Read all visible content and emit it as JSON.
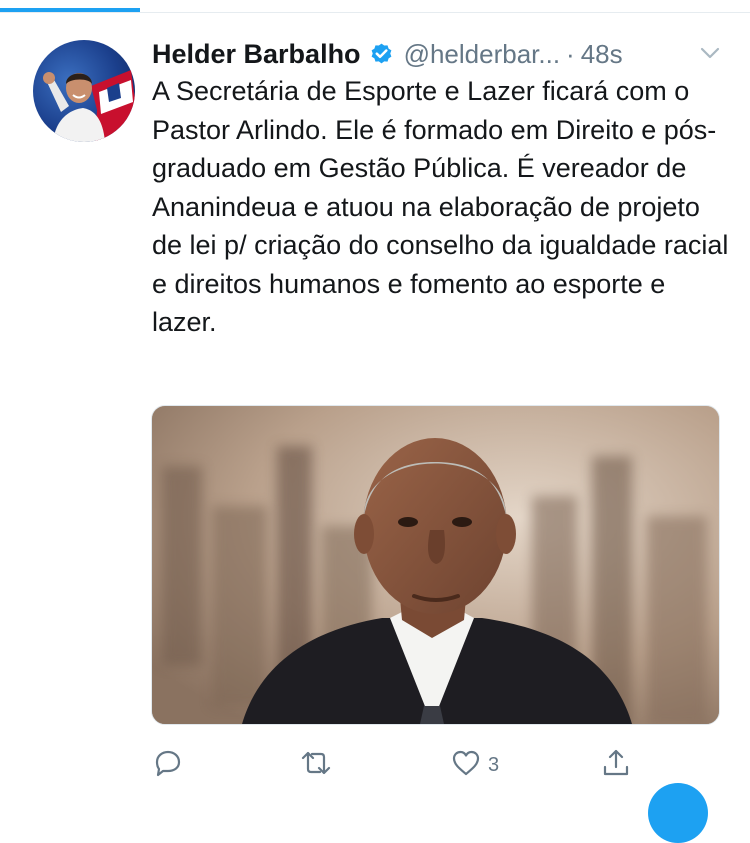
{
  "tweet": {
    "display_name": "Helder Barbalho",
    "handle": "@helderbar...",
    "separator": "·",
    "time": "48s",
    "text": "A Secretária de Esporte e Lazer ficará com o Pastor Arlindo. Ele é formado em Direito e pós-graduado em Gestão Pública. É vereador de Ananindeua e atuou na elaboração de projeto de lei p/ criação do conselho da igualdade racial e direitos humanos e fomento ao esporte e lazer."
  },
  "actions": {
    "like_count": "3"
  },
  "icons": {
    "verified": "verified-badge-icon",
    "more": "chevron-down-icon",
    "reply": "reply-icon",
    "retweet": "retweet-icon",
    "like": "heart-icon",
    "share": "share-icon"
  },
  "colors": {
    "accent": "#1da1f2",
    "text": "#14171a",
    "secondary": "#657786"
  }
}
